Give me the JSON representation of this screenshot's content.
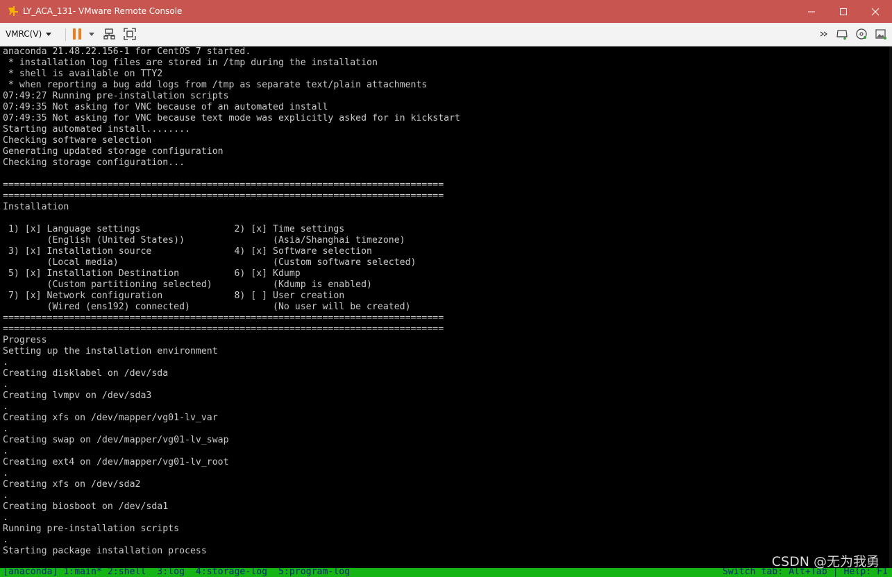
{
  "window": {
    "title": "LY_ACA_131- VMware Remote Console",
    "icon": "vmware-icon",
    "title_color": "#c8554f"
  },
  "toolbar": {
    "menu_label": "VMRC(V)",
    "icons": [
      "pause-icon",
      "dropdown-icon",
      "network-icon",
      "fullscreen-icon",
      "overflow-icon",
      "removable-device-icon",
      "disc-icon",
      "image-icon"
    ]
  },
  "console": {
    "lines": [
      "anaconda 21.48.22.156-1 for CentOS 7 started.",
      " * installation log files are stored in /tmp during the installation",
      " * shell is available on TTY2",
      " * when reporting a bug add logs from /tmp as separate text/plain attachments",
      "07:49:27 Running pre-installation scripts",
      "07:49:35 Not asking for VNC because of an automated install",
      "07:49:35 Not asking for VNC because text mode was explicitly asked for in kickstart",
      "Starting automated install........",
      "Checking software selection",
      "Generating updated storage configuration",
      "Checking storage configuration...",
      "",
      "================================================================================",
      "================================================================================",
      "Installation",
      "",
      " 1) [x] Language settings                 2) [x] Time settings",
      "        (English (United States))                (Asia/Shanghai timezone)",
      " 3) [x] Installation source               4) [x] Software selection",
      "        (Local media)                            (Custom software selected)",
      " 5) [x] Installation Destination          6) [x] Kdump",
      "        (Custom partitioning selected)           (Kdump is enabled)",
      " 7) [x] Network configuration             8) [ ] User creation",
      "        (Wired (ens192) connected)               (No user will be created)",
      "================================================================================",
      "================================================================================",
      "Progress",
      "Setting up the installation environment",
      ".",
      "Creating disklabel on /dev/sda",
      ".",
      "Creating lvmpv on /dev/sda3",
      ".",
      "Creating xfs on /dev/mapper/vg01-lv_var",
      ".",
      "Creating swap on /dev/mapper/vg01-lv_swap",
      ".",
      "Creating ext4 on /dev/mapper/vg01-lv_root",
      ".",
      "Creating xfs on /dev/sda2",
      ".",
      "Creating biosboot on /dev/sda1",
      ".",
      "Running pre-installation scripts",
      ".",
      "Starting package installation process"
    ],
    "text_color": "#c9c9c9"
  },
  "status_bar": {
    "left": "[anaconda] 1:main* 2:shell  3:log  4:storage-log  5:program-log",
    "right": "Switch tab: Alt+Tab | Help: F1",
    "bg_color": "#14b514",
    "text_color": "#06247c"
  },
  "watermark": "CSDN @无为我勇"
}
